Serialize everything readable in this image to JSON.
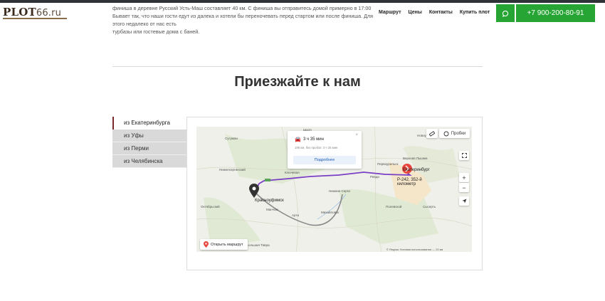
{
  "header": {
    "logo_main": "PLOT",
    "logo_suffix": "66.ru",
    "nav": [
      "Маршрут",
      "Цены",
      "Контакты",
      "Купить плот"
    ],
    "phone": "+7 900-200-80-91"
  },
  "intro": {
    "line1": "финиша в деревне Русский Усть-Маш составляет 40 км. С финиша вы отправитесь домой примерно в 17:00",
    "line2": "Бывает так, что наши гости едут из далека и хотели бы переночевать перед стартом или после финиша. Для этого недалеко от нас есть",
    "line3": "турбазы или гостевые дома с баней."
  },
  "section": {
    "title": "Приезжайте к нам"
  },
  "tabs": [
    {
      "label": "из Екатеринбурга",
      "active": true
    },
    {
      "label": "из Уфы",
      "active": false
    },
    {
      "label": "из Перми",
      "active": false
    },
    {
      "label": "из Челябинска",
      "active": false
    }
  ],
  "map": {
    "route_time": "3 ч 35 мин",
    "route_sub": "196 км, без пробок: 3 ч 25 мин",
    "details_button": "Подробнее",
    "traffic_button": "Пробки",
    "open_route_button": "Открыть маршрут",
    "zoom_in": "+",
    "zoom_out": "−",
    "city_start": "Екатеринбург",
    "city_end": "Красноуфимск",
    "km_label": "Р-242, 352-й километр",
    "footer": "© Яндекс  Условия использования  — 20 км",
    "labels": [
      "Шаля",
      "Сусуман",
      "Нижнесергинский",
      "Ключевая",
      "Октябрьский",
      "Манчаж",
      "Арти",
      "Михайловск",
      "Нижние Серги",
      "Ревда",
      "Первоуральск",
      "Полевской",
      "Сысерть",
      "Верхняя Пышма",
      "Большая Тавра",
      "Новоуральск"
    ]
  },
  "colors": {
    "accent_green": "#27a534",
    "route_purple": "#7a3fc4",
    "route_gray": "#8a8a8a",
    "pin_red": "#e8453c"
  }
}
